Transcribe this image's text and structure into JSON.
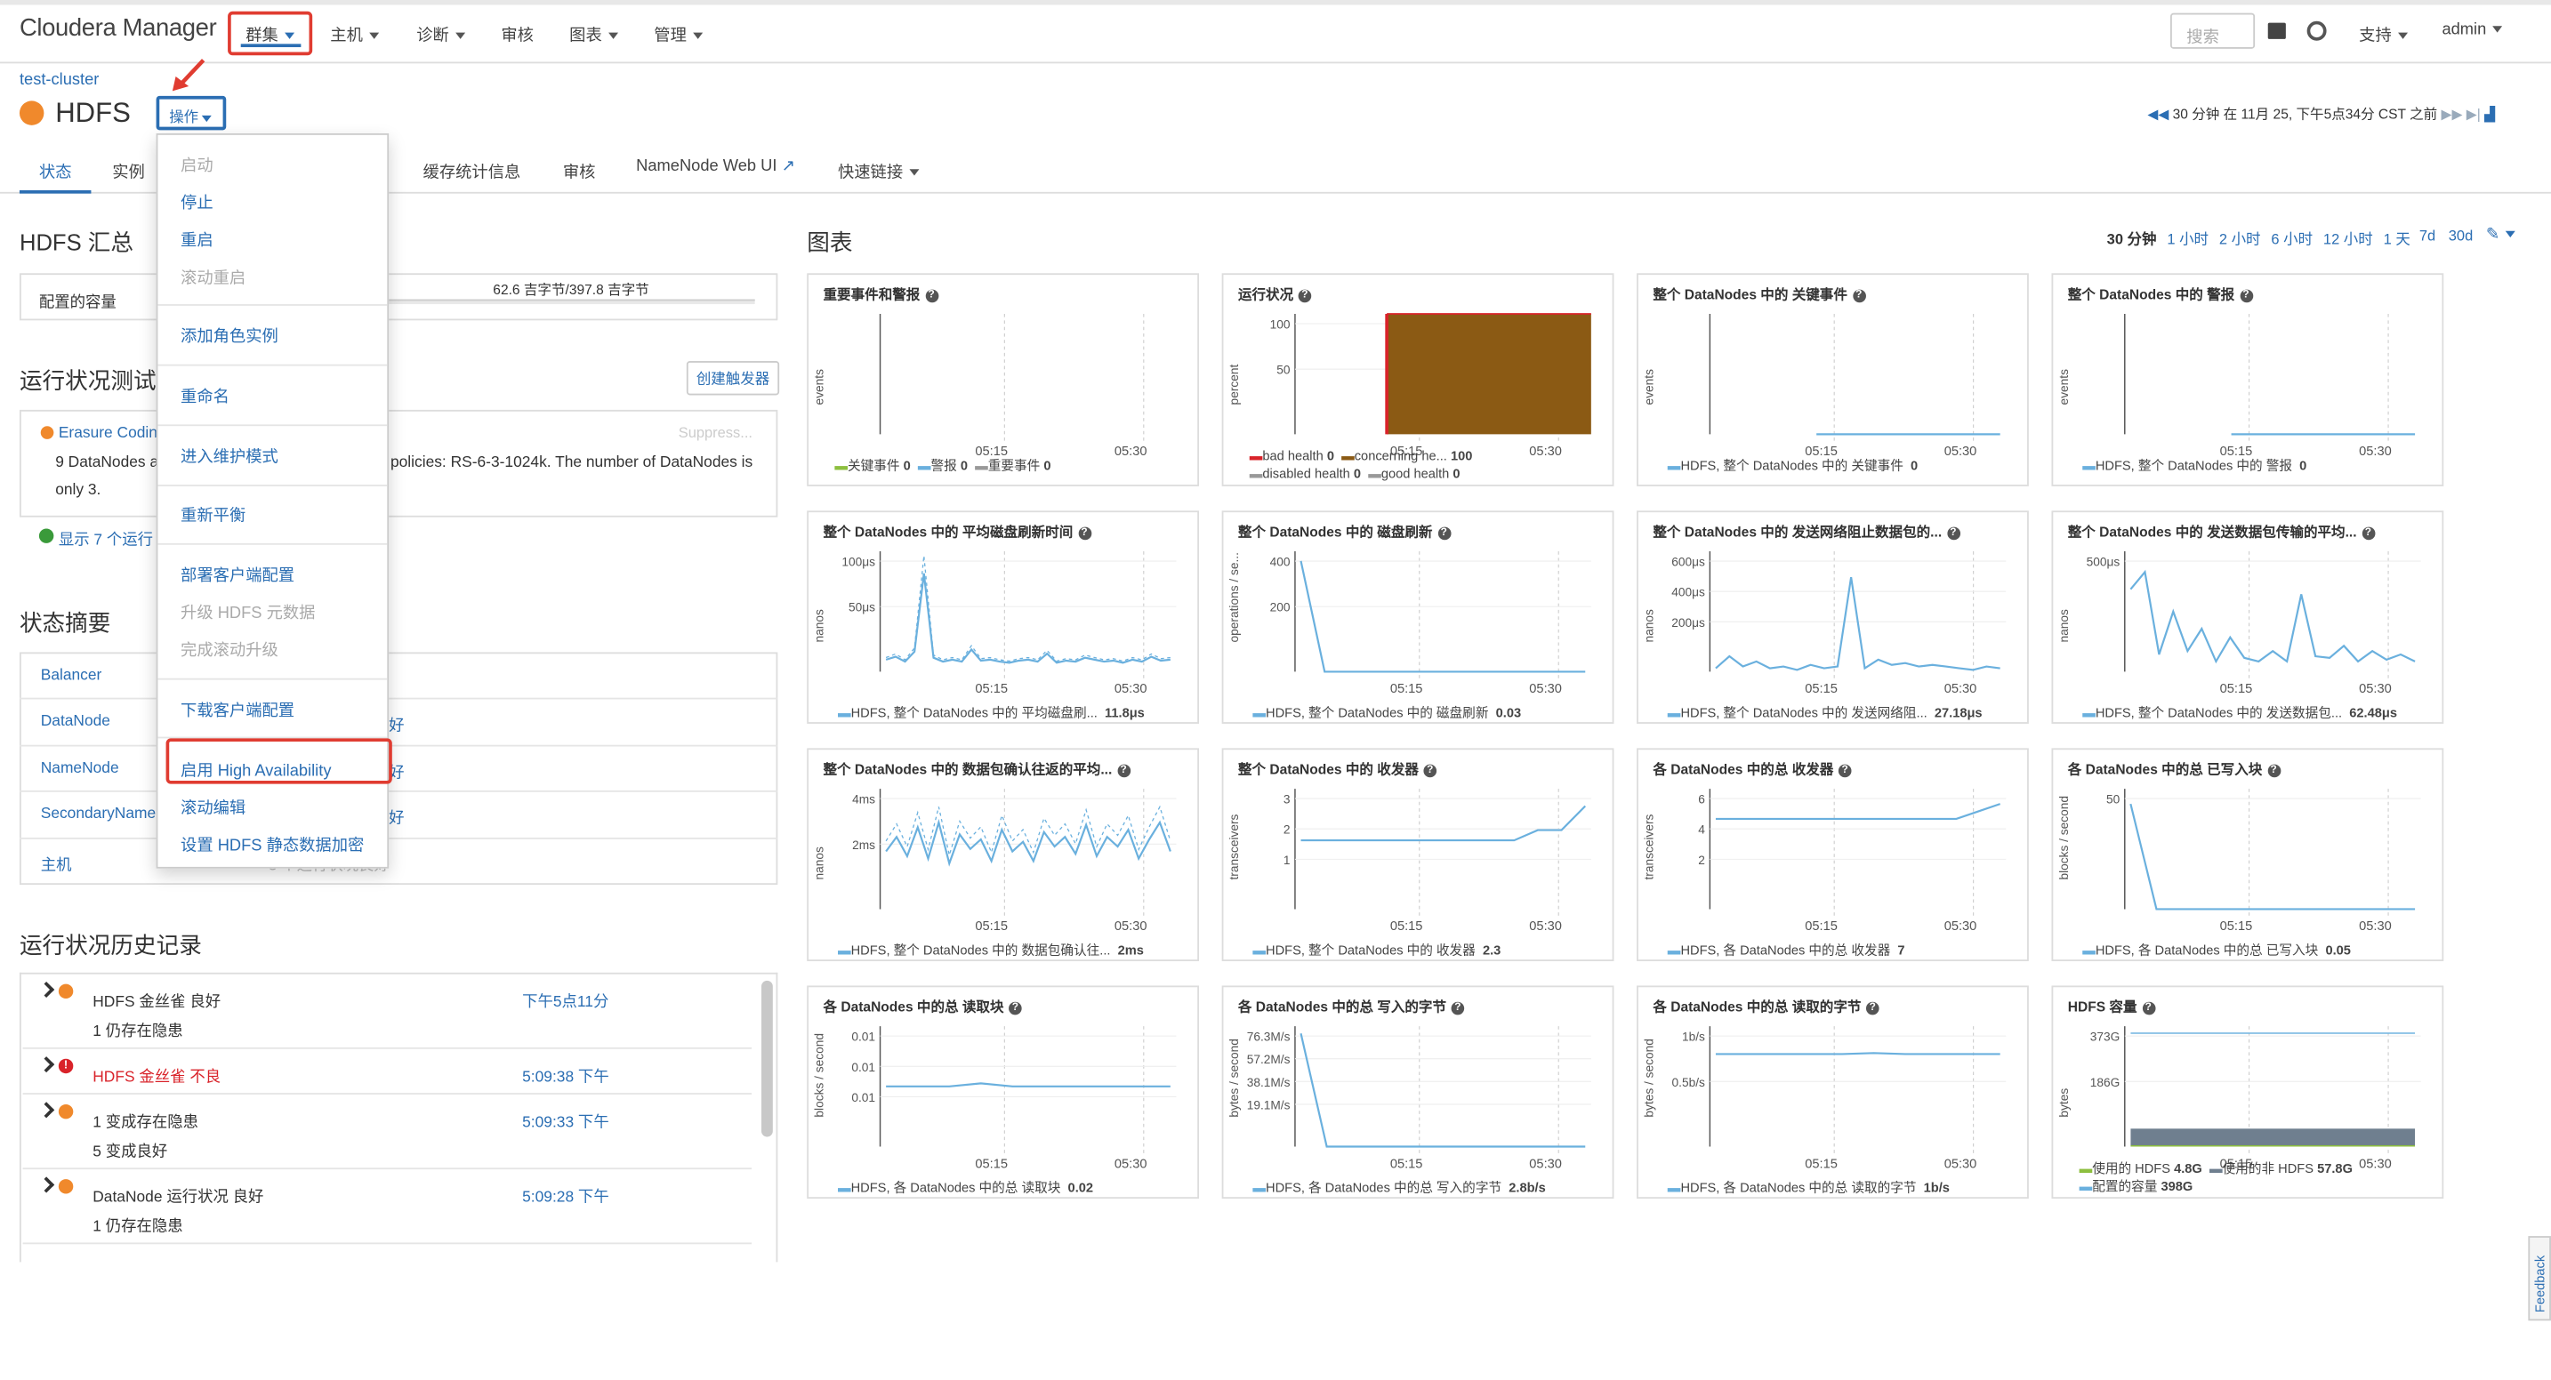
{
  "app": {
    "brand": "Cloudera Manager"
  },
  "topnav": {
    "items": [
      "群集",
      "主机",
      "诊断",
      "审核",
      "图表",
      "管理"
    ],
    "search_placeholder": "搜索",
    "support": "支持",
    "user": "admin"
  },
  "header": {
    "breadcrumb": "test-cluster",
    "service": "HDFS",
    "actions_label": "操作",
    "time_info": "30 分钟 在 11月 25, 下午5点34分 CST 之前"
  },
  "tabs": [
    "状态",
    "实例",
    "缓存统计信息",
    "审核",
    "NameNode Web UI",
    "快速链接"
  ],
  "dropdown": {
    "items": [
      {
        "label": "启动",
        "disabled": true
      },
      {
        "label": "停止",
        "disabled": false
      },
      {
        "label": "重启",
        "disabled": false
      },
      {
        "label": "滚动重启",
        "disabled": true
      },
      {
        "label": "添加角色实例",
        "disabled": false
      },
      {
        "label": "重命名",
        "disabled": false
      },
      {
        "label": "进入维护模式",
        "disabled": false
      },
      {
        "label": "重新平衡",
        "disabled": false
      },
      {
        "label": "部署客户端配置",
        "disabled": false
      },
      {
        "label": "升级 HDFS 元数据",
        "disabled": true
      },
      {
        "label": "完成滚动升级",
        "disabled": true
      },
      {
        "label": "下载客户端配置",
        "disabled": false
      },
      {
        "label": "启用 High Availability",
        "disabled": false
      },
      {
        "label": "滚动编辑",
        "disabled": false
      },
      {
        "label": "设置 HDFS 静态数据加密",
        "disabled": false
      }
    ]
  },
  "summary": {
    "title": "HDFS 汇总",
    "capacity_label": "配置的容量",
    "capacity_value": "62.6 吉字节/397.8 吉字节"
  },
  "health_tests": {
    "title": "运行状况测试",
    "create_trigger": "创建触发器",
    "item_title": "Erasure Coding",
    "suppress": "Suppress...",
    "text_left": "9 DataNodes a",
    "text_right": "policies: RS-6-3-1024k. The number of DataNodes is",
    "text_line2": "only 3.",
    "show_more": "显示 7 个运行"
  },
  "status_summary": {
    "title": "状态摘要",
    "rows": [
      "Balancer",
      "DataNode",
      "NameNode",
      "SecondaryNameNode",
      "主机"
    ],
    "good_suffix": "好",
    "hosts_value": "3 个运行状况良好"
  },
  "history": {
    "title": "运行状况历史记录",
    "rows": [
      {
        "title": "HDFS 金丝雀 良好",
        "sub": "1 仍存在隐患",
        "time": "下午5点11分",
        "status": "concerning"
      },
      {
        "title": "HDFS 金丝雀 不良",
        "sub": "",
        "time": "5:09:38 下午",
        "status": "bad"
      },
      {
        "title": "1 变成存在隐患",
        "sub": "5 变成良好",
        "time": "5:09:33 下午",
        "status": "concerning"
      },
      {
        "title": "DataNode 运行状况 良好",
        "sub": "1 仍存在隐患",
        "time": "5:09:28 下午",
        "status": "concerning"
      }
    ]
  },
  "charts_section": {
    "title": "图表",
    "ranges": [
      "30 分钟",
      "1 小时",
      "2 小时",
      "6 小时",
      "12 小时",
      "1 天",
      "7d",
      "30d"
    ]
  },
  "chart_data": [
    {
      "type": "bar",
      "title": "重要事件和警报",
      "ylabel": "events",
      "x_ticks": [
        "05:15",
        "05:30"
      ],
      "series": [
        {
          "name": "关键事件",
          "last": "0"
        },
        {
          "name": "警报",
          "last": "0"
        },
        {
          "name": "重要事件",
          "last": "0"
        }
      ]
    },
    {
      "type": "area",
      "title": "运行状况",
      "ylabel": "percent",
      "y_ticks": [
        "100",
        "50"
      ],
      "x_ticks": [
        "05:15",
        "05:30"
      ],
      "ylim": [
        0,
        100
      ],
      "series": [
        {
          "name": "bad health",
          "last": "0",
          "color": "#d9232a"
        },
        {
          "name": "concerning he...",
          "last": "100",
          "color": "#8b5a14"
        },
        {
          "name": "disabled health",
          "last": "0"
        },
        {
          "name": "good health",
          "last": "0"
        }
      ]
    },
    {
      "type": "line",
      "title": "整个 DataNodes 中的 关键事件",
      "ylabel": "events",
      "x_ticks": [
        "05:15",
        "05:30"
      ],
      "series": [
        {
          "name": "HDFS, 整个 DataNodes 中的 关键事件",
          "last": "0",
          "values": [
            0,
            0,
            0,
            0,
            0,
            0
          ]
        }
      ]
    },
    {
      "type": "line",
      "title": "整个 DataNodes 中的 警报",
      "ylabel": "events",
      "x_ticks": [
        "05:15",
        "05:30"
      ],
      "series": [
        {
          "name": "HDFS, 整个 DataNodes 中的 警报",
          "last": "0",
          "values": [
            0,
            0,
            0,
            0,
            0,
            0
          ]
        }
      ]
    },
    {
      "type": "line",
      "title": "整个 DataNodes 中的 平均磁盘刷新时间",
      "ylabel": "nanos",
      "y_ticks": [
        "100μs",
        "50μs"
      ],
      "x_ticks": [
        "05:15",
        "05:30"
      ],
      "ylim": [
        0,
        120
      ],
      "series": [
        {
          "name": "HDFS, 整个 DataNodes 中的 平均磁盘刷...",
          "last": "11.8μs",
          "values": [
            12,
            15,
            10,
            20,
            98,
            14,
            10,
            12,
            10,
            22,
            11,
            12,
            10,
            9,
            11,
            12,
            10,
            18,
            9,
            11,
            10,
            14,
            12,
            10,
            11,
            9,
            12,
            10,
            15,
            11,
            12
          ]
        }
      ]
    },
    {
      "type": "line",
      "title": "整个 DataNodes 中的 磁盘刷新",
      "ylabel": "operations / se...",
      "y_ticks": [
        "400",
        "200"
      ],
      "x_ticks": [
        "05:15",
        "05:30"
      ],
      "ylim": [
        0,
        500
      ],
      "series": [
        {
          "name": "HDFS, 整个 DataNodes 中的 磁盘刷新",
          "last": "0.03",
          "values": [
            460,
            0,
            0,
            0,
            0,
            0,
            0,
            0,
            0,
            0,
            0,
            0,
            0
          ]
        }
      ]
    },
    {
      "type": "line",
      "title": "整个 DataNodes 中的 发送网络阻止数据包的...",
      "ylabel": "nanos",
      "y_ticks": [
        "600μs",
        "400μs",
        "200μs"
      ],
      "x_ticks": [
        "05:15",
        "05:30"
      ],
      "ylim": [
        0,
        700
      ],
      "series": [
        {
          "name": "HDFS, 整个 DataNodes 中的 发送网络阻...",
          "last": "27.18μs",
          "values": [
            20,
            90,
            30,
            60,
            20,
            30,
            10,
            40,
            20,
            30,
            550,
            20,
            70,
            40,
            50,
            30,
            40,
            30,
            20,
            10,
            30,
            20
          ]
        }
      ]
    },
    {
      "type": "line",
      "title": "整个 DataNodes 中的 发送数据包传输的平均...",
      "ylabel": "nanos",
      "y_ticks": [
        "500μs"
      ],
      "x_ticks": [
        "05:15",
        "05:30"
      ],
      "ylim": [
        0,
        700
      ],
      "series": [
        {
          "name": "HDFS, 整个 DataNodes 中的 发送数据包...",
          "last": "62.48μs",
          "values": [
            480,
            580,
            100,
            350,
            120,
            250,
            60,
            200,
            80,
            60,
            120,
            60,
            450,
            90,
            80,
            150,
            60,
            120,
            70,
            100,
            60
          ]
        }
      ]
    },
    {
      "type": "line",
      "title": "整个 DataNodes 中的 数据包确认往返的平均...",
      "ylabel": "nanos",
      "y_ticks": [
        "4ms",
        "2ms"
      ],
      "x_ticks": [
        "05:15",
        "05:30"
      ],
      "ylim": [
        0,
        5
      ],
      "series": [
        {
          "name": "HDFS, 整个 DataNodes 中的 数据包确认往...",
          "last": "2ms",
          "values": [
            2.4,
            3.0,
            2.2,
            3.4,
            2.1,
            3.6,
            1.9,
            3.1,
            2.5,
            2.9,
            2.0,
            3.3,
            2.4,
            2.8,
            2.0,
            3.2,
            2.6,
            3.0,
            2.3,
            3.5,
            2.2,
            3.0,
            2.6,
            3.3,
            2.1,
            2.9,
            3.6,
            2.4
          ]
        }
      ]
    },
    {
      "type": "line",
      "title": "整个 DataNodes 中的 收发器",
      "ylabel": "transceivers",
      "y_ticks": [
        "3",
        "2",
        "1"
      ],
      "x_ticks": [
        "05:15",
        "05:30"
      ],
      "ylim": [
        0,
        3.5
      ],
      "series": [
        {
          "name": "HDFS, 整个 DataNodes 中的 收发器",
          "last": "2.3",
          "values": [
            2,
            2,
            2,
            2,
            2,
            2,
            2,
            2,
            2,
            2,
            2.3,
            2.3,
            3
          ]
        }
      ]
    },
    {
      "type": "line",
      "title": "各 DataNodes 中的总 收发器",
      "ylabel": "transceivers",
      "y_ticks": [
        "6",
        "4",
        "2"
      ],
      "x_ticks": [
        "05:15",
        "05:30"
      ],
      "ylim": [
        0,
        8
      ],
      "series": [
        {
          "name": "HDFS, 各 DataNodes 中的总 收发器",
          "last": "7",
          "values": [
            6,
            6,
            6,
            6,
            6,
            6,
            6,
            6,
            6,
            6,
            6,
            6,
            6.5,
            7
          ]
        }
      ]
    },
    {
      "type": "line",
      "title": "各 DataNodes 中的总 已写入块",
      "ylabel": "blocks / second",
      "y_ticks": [
        "50"
      ],
      "x_ticks": [
        "05:15",
        "05:30"
      ],
      "ylim": [
        0,
        80
      ],
      "series": [
        {
          "name": "HDFS, 各 DataNodes 中的总 已写入块",
          "last": "0.05",
          "values": [
            70,
            0,
            0,
            0,
            0,
            0,
            0,
            0,
            0,
            0,
            0,
            0
          ]
        }
      ]
    },
    {
      "type": "line",
      "title": "各 DataNodes 中的总 读取块",
      "ylabel": "blocks / second",
      "y_ticks": [
        "0.01",
        "0.01",
        "0.01"
      ],
      "x_ticks": [
        "05:15",
        "05:30"
      ],
      "ylim": [
        0,
        0.04
      ],
      "series": [
        {
          "name": "HDFS, 各 DataNodes 中的总 读取块",
          "last": "0.02",
          "values": [
            0.02,
            0.02,
            0.02,
            0.021,
            0.02,
            0.02,
            0.02,
            0.02,
            0.02,
            0.02
          ]
        }
      ]
    },
    {
      "type": "line",
      "title": "各 DataNodes 中的总 写入的字节",
      "ylabel": "bytes / second",
      "y_ticks": [
        "76.3M/s",
        "57.2M/s",
        "38.1M/s",
        "19.1M/s"
      ],
      "x_ticks": [
        "05:15",
        "05:30"
      ],
      "ylim": [
        0,
        85
      ],
      "series": [
        {
          "name": "HDFS, 各 DataNodes 中的总 写入的字节",
          "last": "2.8b/s",
          "values": [
            80,
            0,
            0,
            0,
            0,
            0,
            0,
            0,
            0,
            0,
            0,
            0
          ]
        }
      ]
    },
    {
      "type": "line",
      "title": "各 DataNodes 中的总 读取的字节",
      "ylabel": "bytes / second",
      "y_ticks": [
        "1b/s",
        "0.5b/s"
      ],
      "x_ticks": [
        "05:15",
        "05:30"
      ],
      "ylim": [
        0,
        1.3
      ],
      "series": [
        {
          "name": "HDFS, 各 DataNodes 中的总 读取的字节",
          "last": "1b/s",
          "values": [
            1,
            1,
            1,
            1,
            1,
            1.01,
            1,
            1,
            1,
            1
          ]
        }
      ]
    },
    {
      "type": "area",
      "title": "HDFS 容量",
      "ylabel": "bytes",
      "y_ticks": [
        "373G",
        "186G"
      ],
      "x_ticks": [
        "05:15",
        "05:30"
      ],
      "ylim": [
        0,
        420
      ],
      "series": [
        {
          "name": "使用的 HDFS",
          "last": "4.8G",
          "color": "#8dbf3f"
        },
        {
          "name": "使用的非 HDFS",
          "last": "57.8G",
          "color": "#6f7f8f"
        },
        {
          "name": "配置的容量",
          "last": "398G",
          "color": "#6ab0de"
        }
      ]
    }
  ],
  "feedback": "Feedback",
  "colors": {
    "accent": "#2b6eb3",
    "highlight": "#e03c31",
    "status_concerning": "#f0892c",
    "status_bad": "#d9232a",
    "series_line": "#6ab0de"
  }
}
